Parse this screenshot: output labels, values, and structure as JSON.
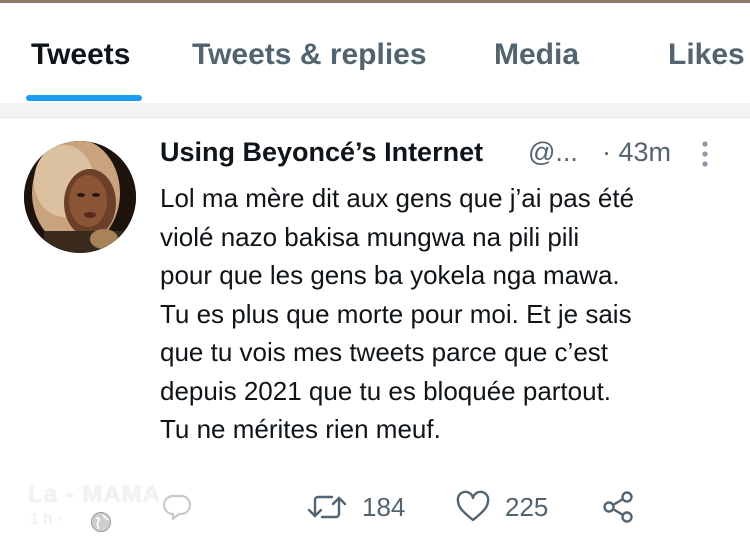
{
  "tabs": [
    {
      "label": "Tweets",
      "active": true
    },
    {
      "label": "Tweets & replies",
      "active": false
    },
    {
      "label": "Media",
      "active": false
    },
    {
      "label": "Likes",
      "active": false
    }
  ],
  "tweet": {
    "display_name": "Using Beyoncé’s Internet",
    "handle": "@...",
    "timestamp": "· 43m",
    "text": "Lol ma mère dit aux gens que j’ai pas été\nviolé nazo bakisa mungwa na pili pili\npour que les gens ba yokela nga mawa.\nTu es plus que morte pour moi. Et je sais\nque tu vois mes tweets parce que c’est\ndepuis 2021 que tu es bloquée partout.\nTu ne mérites rien meuf.",
    "actions": {
      "reply_count": "",
      "retweet_count": "184",
      "like_count": "225"
    }
  },
  "watermark": {
    "title": "La - MAMA",
    "subtitle": "1 h ·"
  },
  "icons": {
    "more": "more-vertical-icon",
    "reply": "reply-icon",
    "retweet": "retweet-icon",
    "like": "heart-icon",
    "share": "share-icon",
    "globe": "globe-icon"
  },
  "colors": {
    "accent": "#1d9bf0",
    "text_primary": "#0f1419",
    "text_secondary": "#536471"
  }
}
